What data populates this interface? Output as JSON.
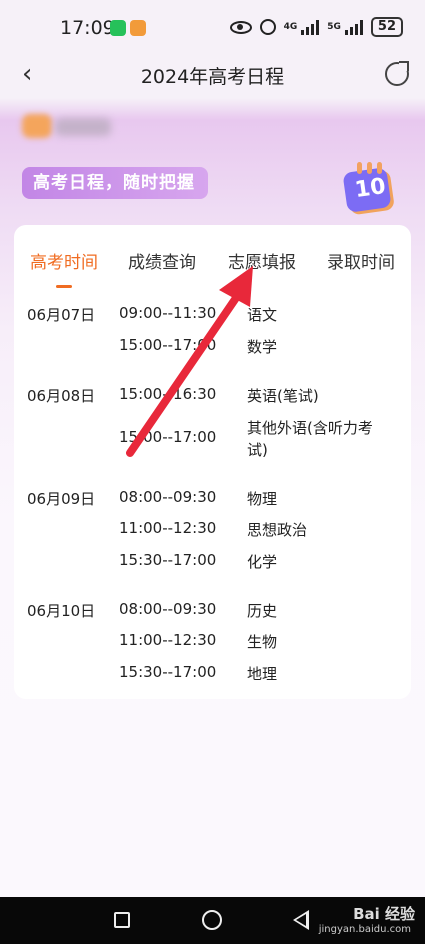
{
  "status_bar": {
    "time": "17:09",
    "net1": "4G",
    "net2": "5G",
    "battery": "52"
  },
  "header": {
    "title": "2024年高考日程",
    "back_icon": "chevron-left-icon",
    "share_icon": "share-icon"
  },
  "banner": {
    "tagline": "高考日程，随时把握",
    "calendar_number": "10"
  },
  "tabs": [
    {
      "label": "高考时间",
      "active": true
    },
    {
      "label": "成绩查询",
      "active": false
    },
    {
      "label": "志愿填报",
      "active": false
    },
    {
      "label": "录取时间",
      "active": false
    }
  ],
  "schedule": [
    {
      "date": "06月07日",
      "slots": [
        {
          "time": "09:00--11:30",
          "subject": "语文"
        },
        {
          "time": "15:00--17:00",
          "subject": "数学"
        }
      ]
    },
    {
      "date": "06月08日",
      "slots": [
        {
          "time": "15:00--16:30",
          "subject": "英语(笔试)"
        },
        {
          "time": "15:00--17:00",
          "subject": "其他外语(含听力考试)"
        }
      ]
    },
    {
      "date": "06月09日",
      "slots": [
        {
          "time": "08:00--09:30",
          "subject": "物理"
        },
        {
          "time": "11:00--12:30",
          "subject": "思想政治"
        },
        {
          "time": "15:30--17:00",
          "subject": "化学"
        }
      ]
    },
    {
      "date": "06月10日",
      "slots": [
        {
          "time": "08:00--09:30",
          "subject": "历史"
        },
        {
          "time": "11:00--12:30",
          "subject": "生物"
        },
        {
          "time": "15:30--17:00",
          "subject": "地理"
        }
      ]
    }
  ],
  "watermark": {
    "brand": "Bai 经验",
    "url": "jingyan.baidu.com"
  },
  "colors": {
    "accent": "#f06c22",
    "annotation_arrow": "#e8283a",
    "tagline_bg": "#c286e6"
  }
}
